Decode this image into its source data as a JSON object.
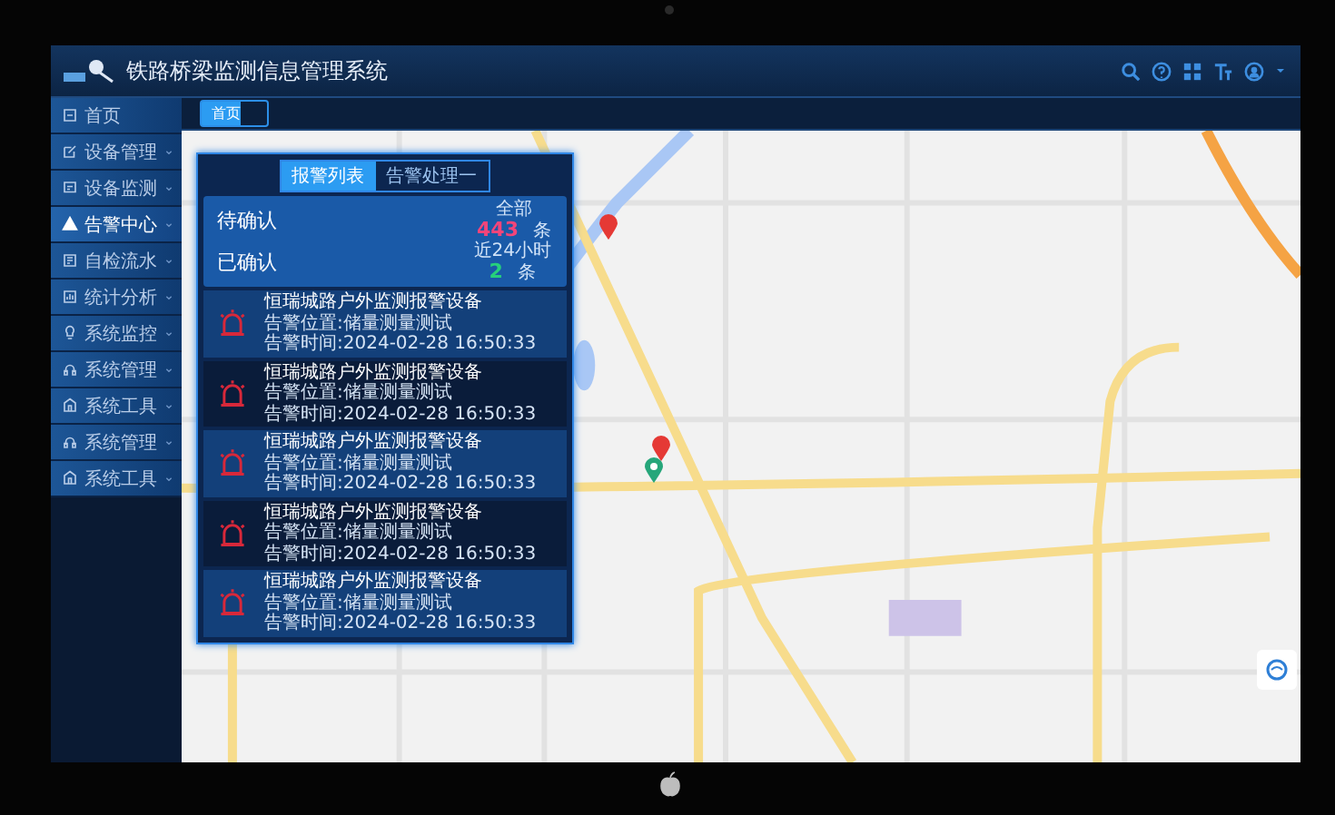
{
  "window": {
    "title": "铁路桥梁监测信息管理系统"
  },
  "tabs": [
    {
      "label": "首页",
      "selected": true
    }
  ],
  "sidebar": {
    "items": [
      {
        "label": "首页",
        "expandable": false,
        "selected": false
      },
      {
        "label": "设备管理",
        "expandable": true,
        "selected": false
      },
      {
        "label": "设备监测",
        "expandable": true,
        "selected": false
      },
      {
        "label": "告警中心",
        "expandable": true,
        "selected": true
      },
      {
        "label": "自检流水",
        "expandable": true,
        "selected": false
      },
      {
        "label": "统计分析",
        "expandable": true,
        "selected": false
      },
      {
        "label": "系统监控",
        "expandable": true,
        "selected": false
      },
      {
        "label": "系统管理",
        "expandable": true,
        "selected": false
      },
      {
        "label": "系统工具",
        "expandable": true,
        "selected": false
      },
      {
        "label": "系统管理",
        "expandable": true,
        "selected": false
      },
      {
        "label": "系统工具",
        "expandable": true,
        "selected": false
      }
    ]
  },
  "alarm_panel": {
    "tabs": [
      {
        "label": "报警列表",
        "selected": true
      },
      {
        "label": "告警处理一",
        "selected": false
      }
    ],
    "summary": {
      "pending_label": "待确认",
      "confirmed_label": "已确认",
      "total_caption": "全部",
      "total_count": "443",
      "total_unit": "条",
      "recent_caption": "近24小时",
      "recent_count": "2",
      "recent_unit": "条"
    },
    "items": [
      {
        "title": "恒瑞城路户外监测报警设备",
        "location": "告警位置:储量测量测试",
        "time": "告警时间:2024-02-28 16:50:33"
      },
      {
        "title": "恒瑞城路户外监测报警设备",
        "location": "告警位置:储量测量测试",
        "time": "告警时间:2024-02-28 16:50:33"
      },
      {
        "title": "恒瑞城路户外监测报警设备",
        "location": "告警位置:储量测量测试",
        "time": "告警时间:2024-02-28 16:50:33"
      },
      {
        "title": "恒瑞城路户外监测报警设备",
        "location": "告警位置:储量测量测试",
        "time": "告警时间:2024-02-28 16:50:33"
      },
      {
        "title": "恒瑞城路户外监测报警设备",
        "location": "告警位置:储量测量测试",
        "time": "告警时间:2024-02-28 16:50:33"
      }
    ]
  }
}
